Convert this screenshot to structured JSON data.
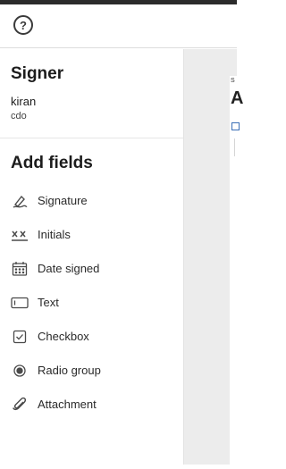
{
  "header": {
    "help_icon": "question-circle-icon",
    "help_glyph": "?"
  },
  "sidebar": {
    "signer_title": "Signer",
    "signer_name": "kiran",
    "signer_role": "cdo",
    "fields_title": "Add fields",
    "fields": [
      {
        "label": "Signature",
        "icon": "signature-icon"
      },
      {
        "label": "Initials",
        "icon": "initials-icon"
      },
      {
        "label": "Date signed",
        "icon": "calendar-icon"
      },
      {
        "label": "Text",
        "icon": "text-field-icon"
      },
      {
        "label": "Checkbox",
        "icon": "checkbox-icon"
      },
      {
        "label": "Radio group",
        "icon": "radio-icon"
      },
      {
        "label": "Attachment",
        "icon": "paperclip-icon"
      }
    ]
  },
  "document": {
    "small_text": "S",
    "big_text": "A"
  }
}
